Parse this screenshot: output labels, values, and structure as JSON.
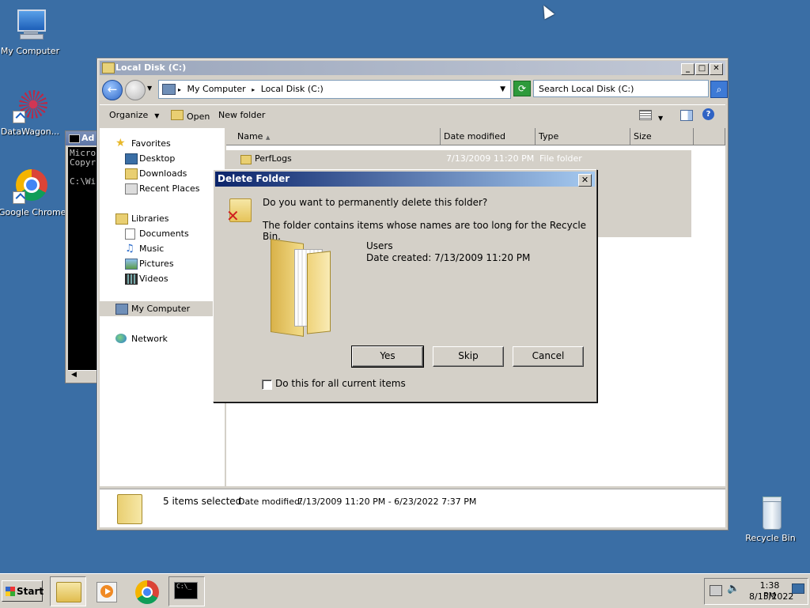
{
  "desktop": {
    "icons": [
      {
        "label": "My Computer",
        "icon": "computer-icon"
      },
      {
        "label": "DataWagon...",
        "icon": "datawagon-icon"
      },
      {
        "label": "Google Chrome",
        "icon": "chrome-icon"
      },
      {
        "label": "Recycle Bin",
        "icon": "recycle-bin-icon"
      }
    ]
  },
  "console": {
    "title": "Ad",
    "lines": [
      "Micro",
      "Copyr",
      "",
      "C:\\Wi"
    ]
  },
  "explorer": {
    "title": "Local Disk (C:)",
    "breadcrumb": [
      "My Computer",
      "Local Disk (C:)"
    ],
    "search_placeholder": "Search Local Disk (C:)",
    "toolbar": {
      "organize": "Organize",
      "open": "Open",
      "new_folder": "New folder"
    },
    "nav": {
      "favorites": "Favorites",
      "desktop": "Desktop",
      "downloads": "Downloads",
      "recent": "Recent Places",
      "libraries": "Libraries",
      "documents": "Documents",
      "music": "Music",
      "pictures": "Pictures",
      "videos": "Videos",
      "my_computer": "My Computer",
      "network": "Network"
    },
    "columns": [
      "Name",
      "Date modified",
      "Type",
      "Size"
    ],
    "rows": [
      {
        "name": "PerfLogs",
        "date": "7/13/2009 11:20 PM",
        "type": "File folder"
      }
    ],
    "details": {
      "selection": "5 items selected",
      "date_label": "Date modified:",
      "date_range": "7/13/2009 11:20 PM - 6/23/2022 7:37 PM"
    }
  },
  "dialog": {
    "title": "Delete Folder",
    "question": "Do you want to permanently delete this folder?",
    "message": "The folder contains items whose names are too long for the Recycle Bin.",
    "item_name": "Users",
    "item_date": "Date created: 7/13/2009 11:20 PM",
    "buttons": {
      "yes": "Yes",
      "skip": "Skip",
      "cancel": "Cancel"
    },
    "checkbox_label": "Do this for all current items",
    "checkbox_checked": false
  },
  "taskbar": {
    "start": "Start",
    "time": "1:38 PM",
    "date": "8/15/2022"
  }
}
